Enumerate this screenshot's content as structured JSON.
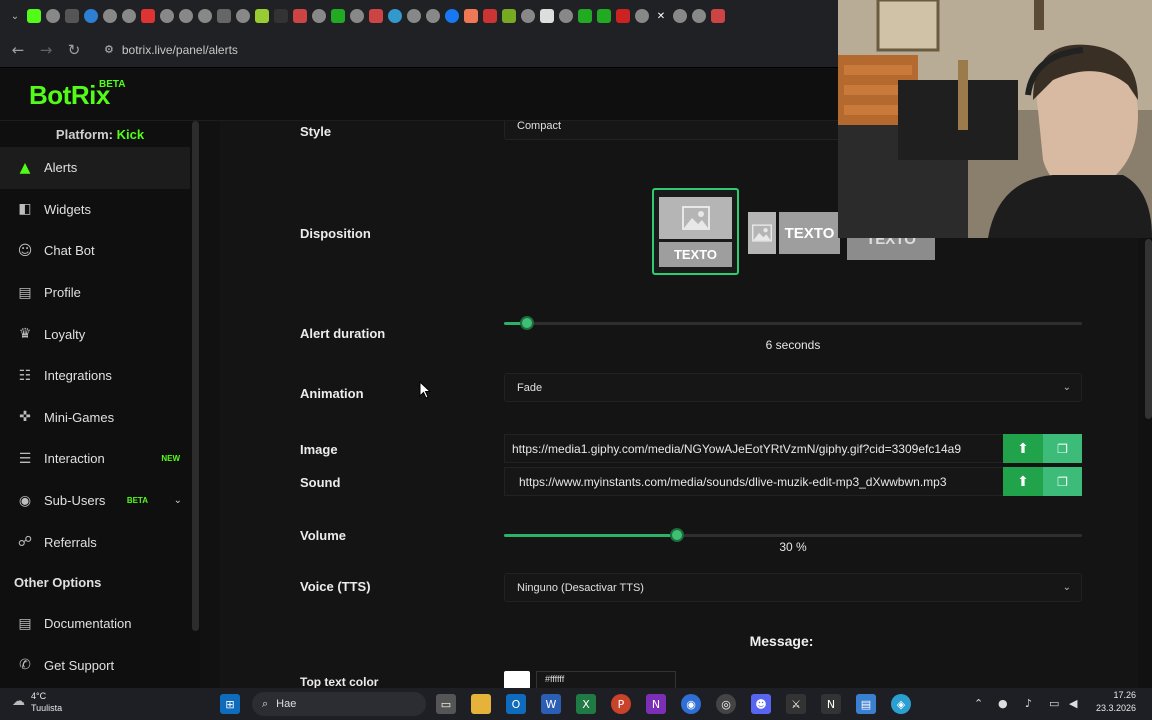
{
  "browser": {
    "url": "botrix.live/panel/alerts"
  },
  "app": {
    "logo": "BotRix",
    "logo_badge": "BETA",
    "platform_prefix": "Platform:",
    "platform_name": "Kick"
  },
  "sidebar": {
    "items": [
      {
        "label": "Alerts",
        "icon": "warning-icon",
        "active": true
      },
      {
        "label": "Widgets",
        "icon": "layers-icon"
      },
      {
        "label": "Chat Bot",
        "icon": "robot-icon"
      },
      {
        "label": "Profile",
        "icon": "profile-card-icon"
      },
      {
        "label": "Loyalty",
        "icon": "trophy-icon"
      },
      {
        "label": "Integrations",
        "icon": "integrations-icon"
      },
      {
        "label": "Mini-Games",
        "icon": "gamepad-icon"
      },
      {
        "label": "Interaction",
        "icon": "interaction-icon",
        "badge": "NEW"
      },
      {
        "label": "Sub-Users",
        "icon": "users-icon",
        "badge": "BETA"
      },
      {
        "label": "Referrals",
        "icon": "referrals-icon"
      }
    ],
    "other_options_heading": "Other Options",
    "other_items": [
      {
        "label": "Documentation",
        "icon": "document-icon"
      },
      {
        "label": "Get Support",
        "icon": "support-icon"
      }
    ]
  },
  "form": {
    "style": {
      "label": "Style",
      "value": "Compact"
    },
    "disposition": {
      "label": "Disposition",
      "option_text": "TEXTO"
    },
    "alert_duration": {
      "label": "Alert duration",
      "value": 6,
      "unit": "seconds",
      "display": "6  seconds",
      "fraction": 0.04
    },
    "animation": {
      "label": "Animation",
      "value": "Fade"
    },
    "image": {
      "label": "Image",
      "value": "https://media1.giphy.com/media/NGYowAJeEotYRtVzmN/giphy.gif?cid=3309efc14a9"
    },
    "sound": {
      "label": "Sound",
      "value": "https://www.myinstants.com/media/sounds/dlive-muzik-edit-mp3_dXwwbwn.mp3"
    },
    "volume": {
      "label": "Volume",
      "value": 30,
      "display": "30  %",
      "fraction": 0.3
    },
    "voice": {
      "label": "Voice (TTS)",
      "value": "Ninguno (Desactivar TTS)"
    },
    "message_heading": "Message:",
    "top_text_color": {
      "label": "Top text color",
      "value": "#ffffff"
    }
  },
  "taskbar": {
    "temperature": "4°C",
    "weather": "Tuulista",
    "search_placeholder": "Hae",
    "time": "17.26",
    "date": "23.3.2026"
  },
  "colors": {
    "accent": "#53fc18",
    "slider": "#2ab365",
    "upload_button": "#21a34c",
    "library_button": "#3dbb78"
  }
}
